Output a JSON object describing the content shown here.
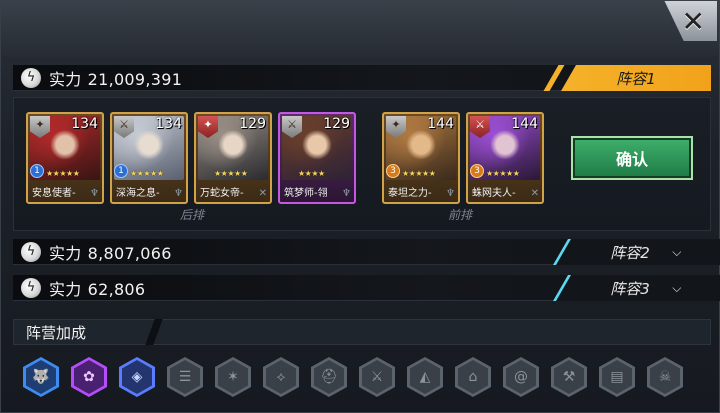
{
  "close_glyph": "✕",
  "lineups": [
    {
      "label": "实力",
      "power": "21,009,391",
      "tab": "阵容1",
      "active": true
    },
    {
      "label": "实力",
      "power": "8,807,066",
      "tab": "阵容2",
      "active": false
    },
    {
      "label": "实力",
      "power": "62,806",
      "tab": "阵容3",
      "active": false
    }
  ],
  "heroes": [
    {
      "name": "安息使者-",
      "level": "134",
      "rank": "1",
      "stars": "★★★★★",
      "frame": "gold",
      "portrait": [
        "#3a1414",
        "#b12a2a",
        "#e3c0a8"
      ]
    },
    {
      "name": "深海之息-",
      "level": "134",
      "rank": "1",
      "stars": "★★★★★",
      "frame": "gold",
      "portrait": [
        "#5a6070",
        "#c6cbd4",
        "#e7dcd0"
      ]
    },
    {
      "name": "万蛇女帝-",
      "level": "129",
      "rank": "",
      "stars": "★★★★★",
      "frame": "gold",
      "portrait": [
        "#2a2b30",
        "#9a8f86",
        "#e7d6c6"
      ]
    },
    {
      "name": "筑梦师-翎",
      "level": "129",
      "rank": "",
      "stars": "★★★★",
      "frame": "purple",
      "portrait": [
        "#2e2236",
        "#6a3f2c",
        "#e8c8a8"
      ]
    },
    {
      "name": "泰坦之力-",
      "level": "144",
      "rank": "3",
      "stars": "★★★★★",
      "frame": "gold",
      "portrait": [
        "#3a2a1c",
        "#b07a42",
        "#e3b98a"
      ]
    },
    {
      "name": "蛛网夫人-",
      "level": "144",
      "rank": "3",
      "stars": "★★★★★",
      "frame": "gold",
      "portrait": [
        "#2a1836",
        "#9b4fd3",
        "#e2c3d2"
      ]
    }
  ],
  "rows": {
    "back": "后排",
    "front": "前排"
  },
  "confirm_label": "确认",
  "camp_label": "阵营加成",
  "factions": [
    {
      "icon": "wolf-icon",
      "glyph": "🐺",
      "state": "active-blue"
    },
    {
      "icon": "flower-icon",
      "glyph": "✿",
      "state": "active-purple"
    },
    {
      "icon": "cube-icon",
      "glyph": "◈",
      "state": "active-indigo"
    },
    {
      "icon": "scroll-icon",
      "glyph": "☰",
      "state": "inactive"
    },
    {
      "icon": "claw-icon",
      "glyph": "✶",
      "state": "inactive"
    },
    {
      "icon": "wings-icon",
      "glyph": "⟡",
      "state": "inactive"
    },
    {
      "icon": "helmet-icon",
      "glyph": "⛑",
      "state": "inactive"
    },
    {
      "icon": "blade-icon",
      "glyph": "⚔",
      "state": "inactive"
    },
    {
      "icon": "beast-icon",
      "glyph": "◭",
      "state": "inactive"
    },
    {
      "icon": "tower-icon",
      "glyph": "⌂",
      "state": "inactive"
    },
    {
      "icon": "spiral-icon",
      "glyph": "@",
      "state": "inactive"
    },
    {
      "icon": "hammer-icon",
      "glyph": "⚒",
      "state": "inactive"
    },
    {
      "icon": "tank-icon",
      "glyph": "▤",
      "state": "inactive"
    },
    {
      "icon": "skull-icon",
      "glyph": "☠",
      "state": "inactive"
    }
  ]
}
